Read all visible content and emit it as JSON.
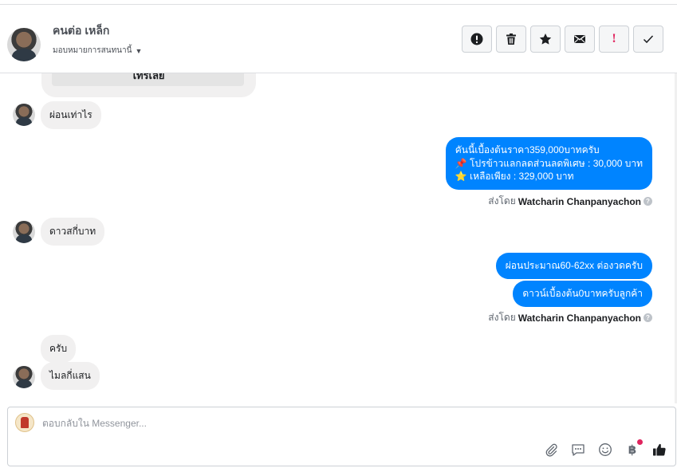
{
  "header": {
    "contact_name": "คนต่อ เหล็ก",
    "assign_label": "มอบหมายการสนทนานี้",
    "actions": [
      {
        "name": "follow-up-icon"
      },
      {
        "name": "trash-icon"
      },
      {
        "name": "star-icon"
      },
      {
        "name": "mail-icon"
      },
      {
        "name": "spam-icon"
      },
      {
        "name": "checkmark-icon"
      }
    ]
  },
  "thread": {
    "try_button_label": "ไทรเลย",
    "msg_1": "ผ่อนเท่าไร",
    "out_1_line_1": "คันนี้เบื้องต้นราคา359,000บาทครับ",
    "out_1_line_2": "📌 โปรข้าวแลกลดส่วนลดพิเศษ : 30,000 บาท",
    "out_1_line_3": "⭐ เหลือเพียง : 329,000 บาท",
    "sent_by_prefix": "ส่งโดย",
    "sender_name": "Watcharin Chanpanyachon",
    "msg_2": "ดาวสกี่บาท",
    "out_2": "ผ่อนประมาณ60-62xx ต่องวดครับ",
    "out_3": "ดาวน์เบื้องต้น0บาทครับลูกค้า",
    "msg_3": "ครับ",
    "msg_4": "ไมลกี่แสน"
  },
  "composer": {
    "placeholder": "ตอบกลับใน Messenger...",
    "baht_symbol": "฿"
  },
  "colors": {
    "outgoing_bubble": "#0084ff",
    "incoming_bubble": "#f1f0f0",
    "alert_red": "#e0245e"
  }
}
